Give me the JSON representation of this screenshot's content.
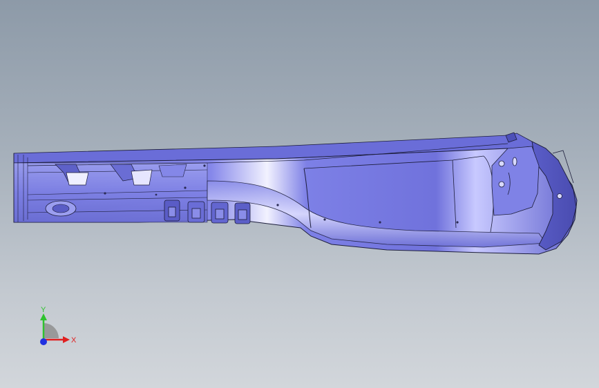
{
  "viewport": {
    "background_top": "#8d9aa8",
    "background_bottom": "#d2d6db"
  },
  "model": {
    "part_color": "#7b7ee6",
    "edge_color": "#1c1d3a",
    "highlight_color": "#e8e8ff"
  },
  "triad": {
    "y_label": "Y",
    "x_label": "X",
    "y_color": "#2fc22f",
    "x_color": "#e02020",
    "z_color": "#2030e0"
  }
}
